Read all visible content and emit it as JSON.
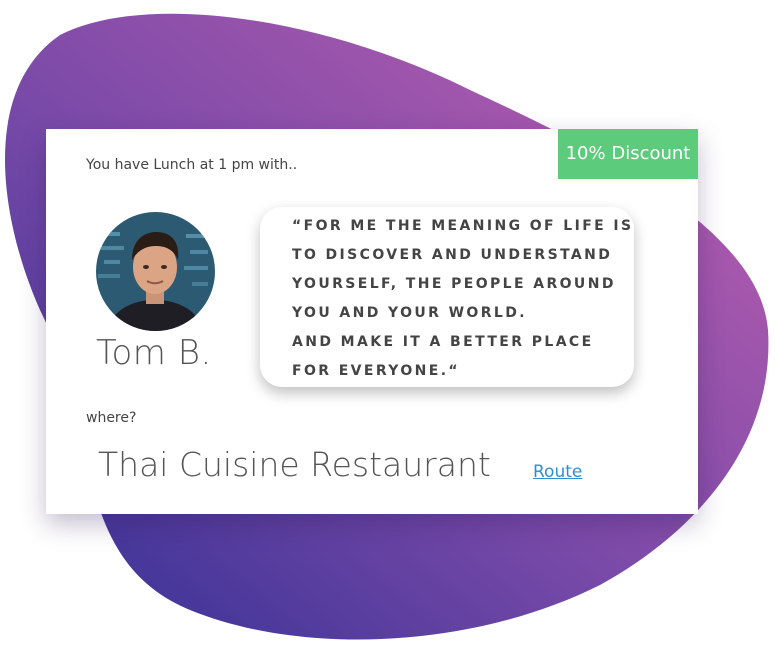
{
  "badge": {
    "label": "10% Discount",
    "color": "#5ccb7b"
  },
  "intro": {
    "text": "You have Lunch at 1 pm with.."
  },
  "person": {
    "name": "Tom B.",
    "avatar_icon": "person-photo-icon"
  },
  "quote": {
    "lines": [
      "“FOR ME THE MEANING OF LIFE IS",
      "TO DISCOVER AND UNDERSTAND",
      "YOURSELF, THE PEOPLE AROUND",
      "YOU AND YOUR WORLD.",
      "AND MAKE IT A BETTER PLACE",
      "FOR EVERYONE.“"
    ]
  },
  "location": {
    "label": "where?",
    "name": "Thai Cuisine Restaurant",
    "route_label": "Route",
    "route_color": "#2b8fd6"
  },
  "background": {
    "gradient_start": "#3a2a8f",
    "gradient_end": "#b45aae"
  }
}
